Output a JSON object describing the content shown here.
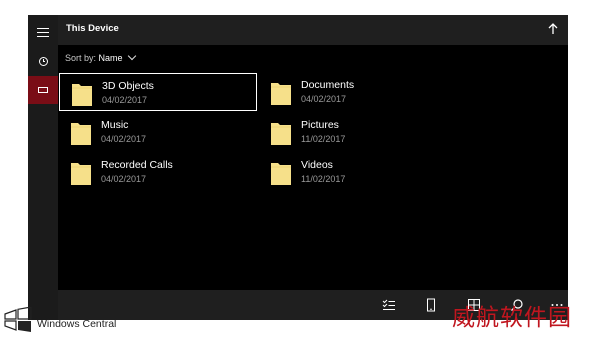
{
  "window": {
    "title": "This Device",
    "sort": {
      "label": "Sort by:",
      "value": "Name"
    }
  },
  "rail": {
    "items": [
      {
        "icon": "hamburger-menu-icon"
      },
      {
        "icon": "recent-clock-icon"
      },
      {
        "icon": "this-device-icon",
        "active": true
      }
    ]
  },
  "files": [
    {
      "name": "3D Objects",
      "date": "04/02/2017",
      "selected": true
    },
    {
      "name": "Documents",
      "date": "04/02/2017"
    },
    {
      "name": "Music",
      "date": "04/02/2017"
    },
    {
      "name": "Pictures",
      "date": "11/02/2017"
    },
    {
      "name": "Recorded Calls",
      "date": "04/02/2017"
    },
    {
      "name": "Videos",
      "date": "11/02/2017"
    }
  ],
  "commandbar": {
    "items": [
      "select-icon",
      "phone-icon",
      "grid-view-icon",
      "search-icon",
      "more-icon"
    ]
  },
  "colors": {
    "accent": "#7a0d16",
    "folder": "#f6e08a",
    "background": "#000000"
  },
  "watermarks": {
    "brand": "Windows Central",
    "site": "威航软件园"
  }
}
